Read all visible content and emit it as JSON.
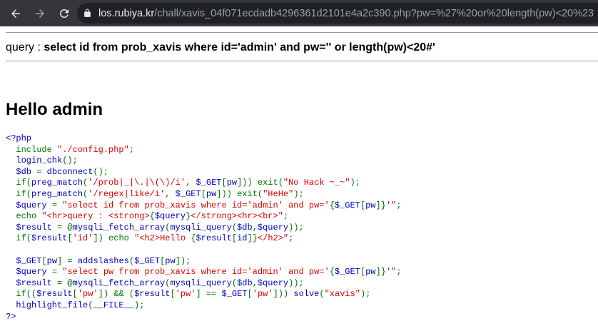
{
  "browser": {
    "url_host": "los.rubiya.kr",
    "url_path": "/chall/xavis_04f071ecdadb4296361d2101e4a2c390.php?pw=%27%20or%20length(pw)<20%23"
  },
  "page": {
    "query_label": "query : ",
    "query_text": "select id from prob_xavis where id='admin' and pw='' or length(pw)<20#'",
    "hello_text": "Hello admin"
  },
  "code_lines": [
    [
      {
        "c": "t",
        "v": "<?php"
      }
    ],
    [
      {
        "c": "t",
        "v": "  "
      },
      {
        "c": "d",
        "v": "include "
      },
      {
        "c": "s",
        "v": "\"./config.php\""
      },
      {
        "c": "d",
        "v": ";"
      }
    ],
    [
      {
        "c": "t",
        "v": "  login_chk"
      },
      {
        "c": "d",
        "v": "();"
      }
    ],
    [
      {
        "c": "t",
        "v": "  $db "
      },
      {
        "c": "d",
        "v": "= "
      },
      {
        "c": "t",
        "v": "dbconnect"
      },
      {
        "c": "d",
        "v": "();"
      }
    ],
    [
      {
        "c": "t",
        "v": "  "
      },
      {
        "c": "d",
        "v": "if("
      },
      {
        "c": "t",
        "v": "preg_match"
      },
      {
        "c": "d",
        "v": "("
      },
      {
        "c": "s",
        "v": "'/prob|_|\\.|\\(\\)/i'"
      },
      {
        "c": "d",
        "v": ", "
      },
      {
        "c": "t",
        "v": "$_GET"
      },
      {
        "c": "d",
        "v": "["
      },
      {
        "c": "t",
        "v": "pw"
      },
      {
        "c": "d",
        "v": "])) exit("
      },
      {
        "c": "s",
        "v": "\"No Hack ~_~\""
      },
      {
        "c": "d",
        "v": ");"
      }
    ],
    [
      {
        "c": "t",
        "v": "  "
      },
      {
        "c": "d",
        "v": "if("
      },
      {
        "c": "t",
        "v": "preg_match"
      },
      {
        "c": "d",
        "v": "("
      },
      {
        "c": "s",
        "v": "'/regex|like/i'"
      },
      {
        "c": "d",
        "v": ", "
      },
      {
        "c": "t",
        "v": "$_GET"
      },
      {
        "c": "d",
        "v": "["
      },
      {
        "c": "t",
        "v": "pw"
      },
      {
        "c": "d",
        "v": "])) exit("
      },
      {
        "c": "s",
        "v": "\"HeHe\""
      },
      {
        "c": "d",
        "v": ");"
      }
    ],
    [
      {
        "c": "t",
        "v": "  $query "
      },
      {
        "c": "d",
        "v": "= "
      },
      {
        "c": "s",
        "v": "\"select id from prob_xavis where id='admin' and pw='"
      },
      {
        "c": "d",
        "v": "{"
      },
      {
        "c": "t",
        "v": "$_GET"
      },
      {
        "c": "d",
        "v": "["
      },
      {
        "c": "t",
        "v": "pw"
      },
      {
        "c": "d",
        "v": "]}"
      },
      {
        "c": "s",
        "v": "'\""
      },
      {
        "c": "d",
        "v": ";"
      }
    ],
    [
      {
        "c": "t",
        "v": "  "
      },
      {
        "c": "d",
        "v": "echo "
      },
      {
        "c": "s",
        "v": "\"<hr>query : <strong>"
      },
      {
        "c": "d",
        "v": "{"
      },
      {
        "c": "t",
        "v": "$query"
      },
      {
        "c": "d",
        "v": "}"
      },
      {
        "c": "s",
        "v": "</strong><hr><br>\""
      },
      {
        "c": "d",
        "v": ";"
      }
    ],
    [
      {
        "c": "t",
        "v": "  $result "
      },
      {
        "c": "d",
        "v": "= @"
      },
      {
        "c": "t",
        "v": "mysqli_fetch_array"
      },
      {
        "c": "d",
        "v": "("
      },
      {
        "c": "t",
        "v": "mysqli_query"
      },
      {
        "c": "d",
        "v": "("
      },
      {
        "c": "t",
        "v": "$db"
      },
      {
        "c": "d",
        "v": ","
      },
      {
        "c": "t",
        "v": "$query"
      },
      {
        "c": "d",
        "v": "));"
      }
    ],
    [
      {
        "c": "t",
        "v": "  "
      },
      {
        "c": "d",
        "v": "if("
      },
      {
        "c": "t",
        "v": "$result"
      },
      {
        "c": "d",
        "v": "["
      },
      {
        "c": "s",
        "v": "'id'"
      },
      {
        "c": "d",
        "v": "]) echo "
      },
      {
        "c": "s",
        "v": "\"<h2>Hello "
      },
      {
        "c": "d",
        "v": "{"
      },
      {
        "c": "t",
        "v": "$result"
      },
      {
        "c": "d",
        "v": "["
      },
      {
        "c": "t",
        "v": "id"
      },
      {
        "c": "d",
        "v": "]}"
      },
      {
        "c": "s",
        "v": "</h2>\""
      },
      {
        "c": "d",
        "v": ";"
      }
    ],
    [
      {
        "c": "t",
        "v": ""
      }
    ],
    [
      {
        "c": "t",
        "v": "  $_GET"
      },
      {
        "c": "d",
        "v": "["
      },
      {
        "c": "t",
        "v": "pw"
      },
      {
        "c": "d",
        "v": "] = "
      },
      {
        "c": "t",
        "v": "addslashes"
      },
      {
        "c": "d",
        "v": "("
      },
      {
        "c": "t",
        "v": "$_GET"
      },
      {
        "c": "d",
        "v": "["
      },
      {
        "c": "t",
        "v": "pw"
      },
      {
        "c": "d",
        "v": "]);"
      }
    ],
    [
      {
        "c": "t",
        "v": "  $query "
      },
      {
        "c": "d",
        "v": "= "
      },
      {
        "c": "s",
        "v": "\"select pw from prob_xavis where id='admin' and pw='"
      },
      {
        "c": "d",
        "v": "{"
      },
      {
        "c": "t",
        "v": "$_GET"
      },
      {
        "c": "d",
        "v": "["
      },
      {
        "c": "t",
        "v": "pw"
      },
      {
        "c": "d",
        "v": "]}"
      },
      {
        "c": "s",
        "v": "'\""
      },
      {
        "c": "d",
        "v": ";"
      }
    ],
    [
      {
        "c": "t",
        "v": "  $result "
      },
      {
        "c": "d",
        "v": "= @"
      },
      {
        "c": "t",
        "v": "mysqli_fetch_array"
      },
      {
        "c": "d",
        "v": "("
      },
      {
        "c": "t",
        "v": "mysqli_query"
      },
      {
        "c": "d",
        "v": "("
      },
      {
        "c": "t",
        "v": "$db"
      },
      {
        "c": "d",
        "v": ","
      },
      {
        "c": "t",
        "v": "$query"
      },
      {
        "c": "d",
        "v": "));"
      }
    ],
    [
      {
        "c": "t",
        "v": "  "
      },
      {
        "c": "d",
        "v": "if(("
      },
      {
        "c": "t",
        "v": "$result"
      },
      {
        "c": "d",
        "v": "["
      },
      {
        "c": "s",
        "v": "'pw'"
      },
      {
        "c": "d",
        "v": "]) && ("
      },
      {
        "c": "t",
        "v": "$result"
      },
      {
        "c": "d",
        "v": "["
      },
      {
        "c": "s",
        "v": "'pw'"
      },
      {
        "c": "d",
        "v": "] == "
      },
      {
        "c": "t",
        "v": "$_GET"
      },
      {
        "c": "d",
        "v": "["
      },
      {
        "c": "s",
        "v": "'pw'"
      },
      {
        "c": "d",
        "v": "])) "
      },
      {
        "c": "t",
        "v": "solve"
      },
      {
        "c": "d",
        "v": "("
      },
      {
        "c": "s",
        "v": "\"xavis\""
      },
      {
        "c": "d",
        "v": ");"
      }
    ],
    [
      {
        "c": "t",
        "v": "  highlight_file"
      },
      {
        "c": "d",
        "v": "("
      },
      {
        "c": "t",
        "v": "__FILE__"
      },
      {
        "c": "d",
        "v": ");"
      }
    ],
    [
      {
        "c": "t",
        "v": "?>"
      }
    ]
  ]
}
